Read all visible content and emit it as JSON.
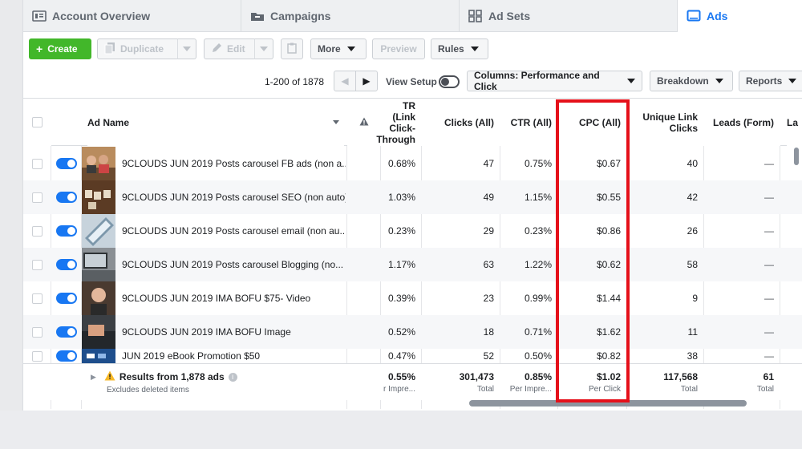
{
  "tabs": [
    {
      "label": "Account Overview",
      "icon": "grid-icon"
    },
    {
      "label": "Campaigns",
      "icon": "folder-icon"
    },
    {
      "label": "Ad Sets",
      "icon": "grid-icon"
    },
    {
      "label": "Ads",
      "icon": "ad-icon"
    }
  ],
  "toolbar": {
    "create": "Create",
    "duplicate": "Duplicate",
    "edit": "Edit",
    "more": "More",
    "preview": "Preview",
    "rules": "Rules"
  },
  "toolbar2": {
    "pager": "1-200 of 1878",
    "view_setup": "View Setup",
    "columns": "Columns: Performance and Click",
    "breakdown": "Breakdown",
    "reports": "Reports"
  },
  "table": {
    "headers": {
      "ad_name": "Ad Name",
      "ctr_link_1": "TR (Link",
      "ctr_link_2": "Click-",
      "ctr_link_3": "Through",
      "clicks": "Clicks (All)",
      "ctr": "CTR (All)",
      "cpc": "CPC (All)",
      "unique_1": "Unique Link",
      "unique_2": "Clicks",
      "leads": "Leads (Form)",
      "last": "La"
    },
    "rows": [
      {
        "name": "9CLOUDS JUN 2019 Posts carousel FB ads (non a...",
        "ctr_link": "0.68%",
        "clicks": "47",
        "ctr": "0.75%",
        "cpc": "$0.67",
        "unique": "40",
        "leads": "—"
      },
      {
        "name": "9CLOUDS JUN 2019 Posts carousel SEO (non auto)",
        "ctr_link": "1.03%",
        "clicks": "49",
        "ctr": "1.15%",
        "cpc": "$0.55",
        "unique": "42",
        "leads": "—"
      },
      {
        "name": "9CLOUDS JUN 2019 Posts carousel email (non au...",
        "ctr_link": "0.23%",
        "clicks": "29",
        "ctr": "0.23%",
        "cpc": "$0.86",
        "unique": "26",
        "leads": "—"
      },
      {
        "name": "9CLOUDS JUN 2019 Posts carousel Blogging (no...",
        "ctr_link": "1.17%",
        "clicks": "63",
        "ctr": "1.22%",
        "cpc": "$0.62",
        "unique": "58",
        "leads": "—"
      },
      {
        "name": "9CLOUDS JUN 2019 IMA BOFU $75- Video",
        "ctr_link": "0.39%",
        "clicks": "23",
        "ctr": "0.99%",
        "cpc": "$1.44",
        "unique": "9",
        "leads": "—"
      },
      {
        "name": "9CLOUDS JUN 2019 IMA BOFU Image",
        "ctr_link": "0.52%",
        "clicks": "18",
        "ctr": "0.71%",
        "cpc": "$1.62",
        "unique": "11",
        "leads": "—"
      },
      {
        "name": "JUN 2019 eBook Promotion $50",
        "ctr_link": "0.47%",
        "clicks": "52",
        "ctr": "0.50%",
        "cpc": "$0.82",
        "unique": "38",
        "leads": "—"
      }
    ],
    "footer": {
      "results": "Results from 1,878 ads",
      "excludes": "Excludes deleted items",
      "ctr_link": "0.55%",
      "ctr_link_sub": "r Impre...",
      "clicks": "301,473",
      "clicks_sub": "Total",
      "ctr": "0.85%",
      "ctr_sub": "Per Impre...",
      "cpc": "$1.02",
      "cpc_sub": "Per Click",
      "unique": "117,568",
      "unique_sub": "Total",
      "leads": "61",
      "leads_sub": "Total"
    }
  },
  "colors": {
    "accent": "#1877f2",
    "create": "#42b72a",
    "highlight": "#e5101a"
  }
}
